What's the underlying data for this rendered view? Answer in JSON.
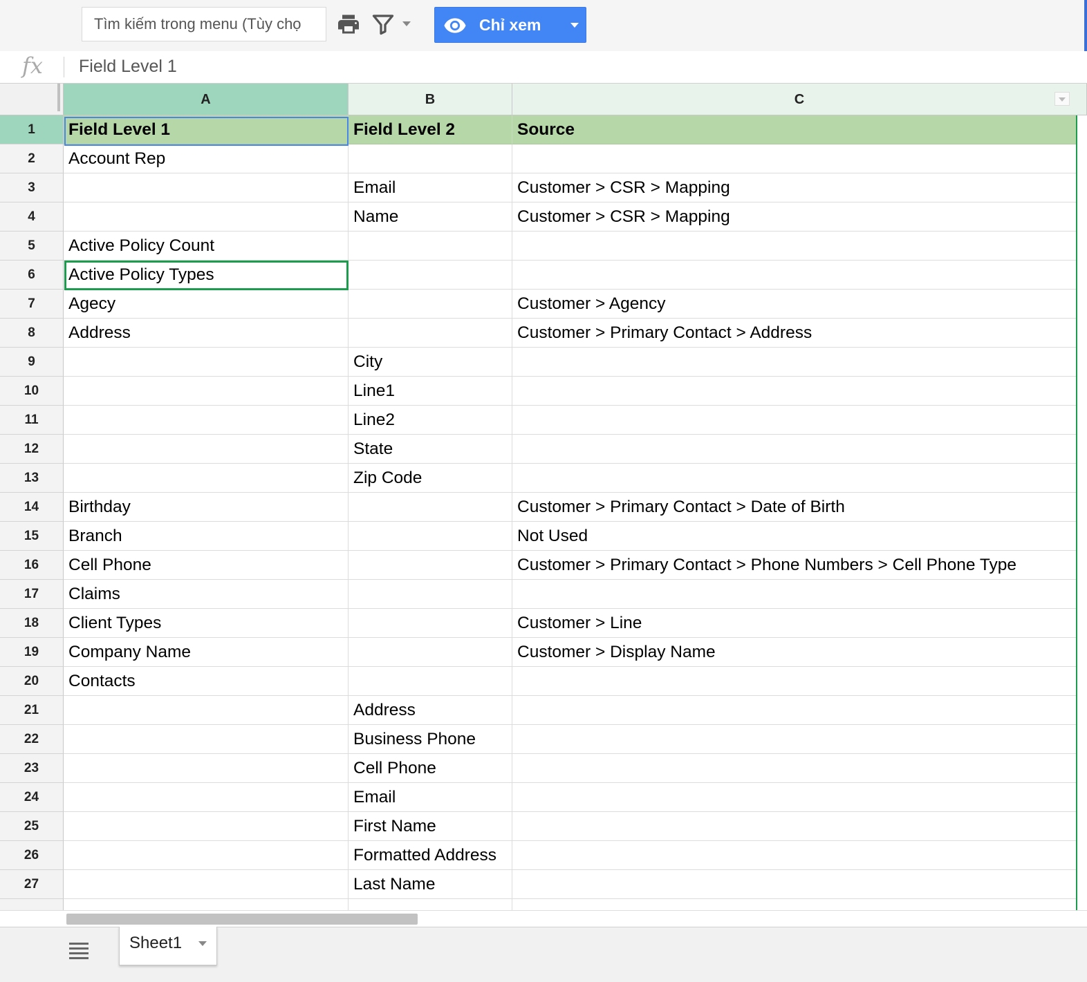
{
  "toolbar": {
    "menu_search_placeholder": "Tìm kiếm trong menu (Tùy chọ",
    "print_icon": "printer-icon",
    "filter_icon": "filter-icon",
    "view_mode_label": "Chỉ xem",
    "view_mode_icon": "eye-icon",
    "accent_color": "#4285f4"
  },
  "formula_bar": {
    "fx_label": "fx",
    "content": "Field Level 1"
  },
  "columns": [
    "A",
    "B",
    "C"
  ],
  "rows": [
    {
      "n": "1",
      "a": "Field Level 1",
      "b": "Field Level 2",
      "c": "Source"
    },
    {
      "n": "2",
      "a": "Account Rep",
      "b": "",
      "c": ""
    },
    {
      "n": "3",
      "a": "",
      "b": "Email",
      "c": "Customer > CSR > Mapping"
    },
    {
      "n": "4",
      "a": "",
      "b": "Name",
      "c": "Customer > CSR > Mapping"
    },
    {
      "n": "5",
      "a": "Active Policy Count",
      "b": "",
      "c": ""
    },
    {
      "n": "6",
      "a": "Active Policy Types",
      "b": "",
      "c": ""
    },
    {
      "n": "7",
      "a": "Agecy",
      "b": "",
      "c": "Customer > Agency"
    },
    {
      "n": "8",
      "a": "Address",
      "b": "",
      "c": "Customer > Primary Contact > Address"
    },
    {
      "n": "9",
      "a": "",
      "b": "City",
      "c": ""
    },
    {
      "n": "10",
      "a": "",
      "b": "Line1",
      "c": ""
    },
    {
      "n": "11",
      "a": "",
      "b": "Line2",
      "c": ""
    },
    {
      "n": "12",
      "a": "",
      "b": "State",
      "c": ""
    },
    {
      "n": "13",
      "a": "",
      "b": "Zip Code",
      "c": ""
    },
    {
      "n": "14",
      "a": "Birthday",
      "b": "",
      "c": "Customer > Primary Contact > Date of Birth"
    },
    {
      "n": "15",
      "a": "Branch",
      "b": "",
      "c": "Not Used"
    },
    {
      "n": "16",
      "a": "Cell Phone",
      "b": "",
      "c": "Customer > Primary Contact > Phone Numbers > Cell Phone Type"
    },
    {
      "n": "17",
      "a": "Claims",
      "b": "",
      "c": ""
    },
    {
      "n": "18",
      "a": "Client Types",
      "b": "",
      "c": "Customer > Line"
    },
    {
      "n": "19",
      "a": "Company Name",
      "b": "",
      "c": "Customer > Display Name"
    },
    {
      "n": "20",
      "a": "Contacts",
      "b": "",
      "c": ""
    },
    {
      "n": "21",
      "a": "",
      "b": "Address",
      "c": ""
    },
    {
      "n": "22",
      "a": "",
      "b": "Business Phone",
      "c": ""
    },
    {
      "n": "23",
      "a": "",
      "b": "Cell Phone",
      "c": ""
    },
    {
      "n": "24",
      "a": "",
      "b": "Email",
      "c": ""
    },
    {
      "n": "25",
      "a": "",
      "b": "First Name",
      "c": ""
    },
    {
      "n": "26",
      "a": "",
      "b": "Formatted Address",
      "c": ""
    },
    {
      "n": "27",
      "a": "",
      "b": "Last Name",
      "c": ""
    }
  ],
  "sheet_tabs": {
    "menu_icon": "all-sheets-menu-icon",
    "active": "Sheet1"
  },
  "colors": {
    "header_row_fill": "#b6d7a8",
    "active_header_fill": "#9ed6bd",
    "selection_blue": "#4a86e8",
    "selection_green": "#1e9c4d"
  }
}
